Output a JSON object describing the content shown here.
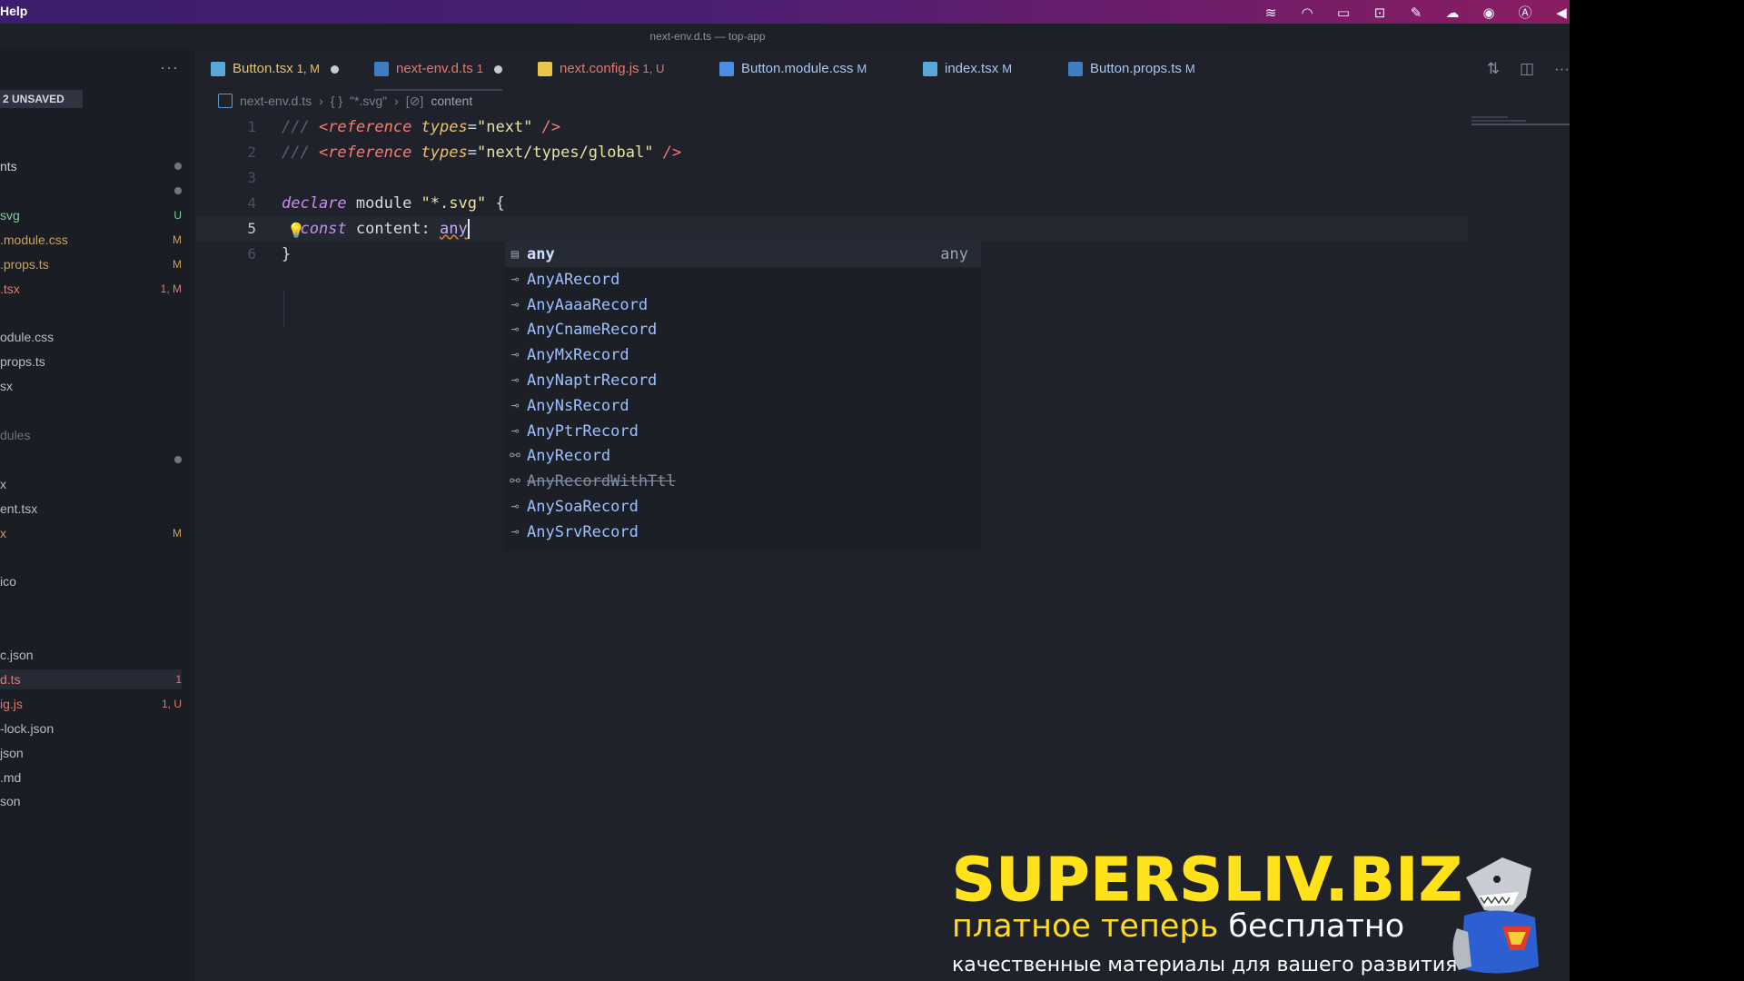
{
  "menubar": {
    "help": "Help",
    "tray_icons": [
      "stripe-icon",
      "headphones-icon",
      "card-icon",
      "camera-icon",
      "feather-icon",
      "cloud-icon",
      "compass-icon",
      "a-icon",
      "volume-icon"
    ]
  },
  "window": {
    "title": "next-env.d.ts — top-app"
  },
  "sidebar": {
    "more": "···",
    "unsaved": "2 UNSAVED",
    "files": [
      {
        "name": "nts",
        "badge": "",
        "color": "#c9cdd6",
        "dot": true
      },
      {
        "name": "",
        "badge": "",
        "color": "#c9cdd6",
        "dot": true
      },
      {
        "name": "svg",
        "badge": "U",
        "color": "#7ad39a"
      },
      {
        "name": ".module.css",
        "badge": "M",
        "color": "#c9a35a"
      },
      {
        "name": ".props.ts",
        "badge": "M",
        "color": "#c9a35a"
      },
      {
        "name": ".tsx",
        "badge": "1, M",
        "color": "#e07a70"
      },
      {
        "name": "",
        "badge": "",
        "color": "#c9cdd6"
      },
      {
        "name": "odule.css",
        "badge": "",
        "color": "#b8bcc6"
      },
      {
        "name": "props.ts",
        "badge": "",
        "color": "#b8bcc6"
      },
      {
        "name": "sx",
        "badge": "",
        "color": "#b8bcc6"
      },
      {
        "name": "",
        "badge": "",
        "color": "#c9cdd6"
      },
      {
        "name": "dules",
        "badge": "",
        "color": "#6c7180"
      },
      {
        "name": "",
        "badge": "",
        "color": "#c9cdd6",
        "dot": true
      },
      {
        "name": "x",
        "badge": "",
        "color": "#b8bcc6"
      },
      {
        "name": "ent.tsx",
        "badge": "",
        "color": "#b8bcc6"
      },
      {
        "name": "x",
        "badge": "M",
        "color": "#c9a35a"
      },
      {
        "name": "",
        "badge": "",
        "color": "#c9cdd6"
      },
      {
        "name": "ico",
        "badge": "",
        "color": "#b8bcc6"
      },
      {
        "name": "",
        "badge": "",
        "color": "#c9cdd6"
      },
      {
        "name": "",
        "badge": "",
        "color": "#c9cdd6"
      },
      {
        "name": "c.json",
        "badge": "",
        "color": "#b8bcc6"
      },
      {
        "name": "d.ts",
        "badge": "1",
        "color": "#e07a70",
        "selected": true
      },
      {
        "name": "ig.js",
        "badge": "1, U",
        "color": "#e07a70"
      },
      {
        "name": "-lock.json",
        "badge": "",
        "color": "#b8bcc6"
      },
      {
        "name": "json",
        "badge": "",
        "color": "#b8bcc6"
      },
      {
        "name": ".md",
        "badge": "",
        "color": "#b8bcc6"
      },
      {
        "name": "son",
        "badge": "",
        "color": "#b8bcc6"
      }
    ]
  },
  "tabs": [
    {
      "label": "Button.tsx",
      "status": "1, M",
      "dirty": true,
      "color": "#e3c275",
      "icon_color": "#5aa8d9",
      "icon": "react-icon"
    },
    {
      "label": "next-env.d.ts",
      "status": "1",
      "dirty": true,
      "color": "#e07a70",
      "icon_color": "#3d7fc1",
      "icon": "typescript-icon",
      "active": true
    },
    {
      "label": "next.config.js",
      "status": "1, U",
      "dirty": false,
      "color": "#e07a70",
      "icon_color": "#e6c54a",
      "icon": "javascript-icon"
    },
    {
      "label": "Button.module.css",
      "status": "M",
      "dirty": false,
      "color": "#a9c6f2",
      "icon_color": "#4c8fe0",
      "icon": "css-icon"
    },
    {
      "label": "index.tsx",
      "status": "M",
      "dirty": false,
      "color": "#a9c6f2",
      "icon_color": "#5aa8d9",
      "icon": "react-icon"
    },
    {
      "label": "Button.props.ts",
      "status": "M",
      "dirty": false,
      "color": "#a9c6f2",
      "icon_color": "#3d7fc1",
      "icon": "typescript-icon"
    }
  ],
  "editor_actions": [
    "source-control-icon",
    "split-editor-icon",
    "more-actions-icon"
  ],
  "breadcrumb": {
    "file": "next-env.d.ts",
    "module": "\"*.svg\"",
    "symbol": "content"
  },
  "code_lines": [
    {
      "n": "1",
      "tokens": [
        [
          "c-comment",
          "/// "
        ],
        [
          "c-tag",
          "<reference "
        ],
        [
          "c-attr",
          "types"
        ],
        [
          "c-punc",
          "="
        ],
        [
          "c-str",
          "\"next\""
        ],
        [
          "c-tag",
          " />"
        ]
      ]
    },
    {
      "n": "2",
      "tokens": [
        [
          "c-comment",
          "/// "
        ],
        [
          "c-tag",
          "<reference "
        ],
        [
          "c-attr",
          "types"
        ],
        [
          "c-punc",
          "="
        ],
        [
          "c-str",
          "\"next/types/global\""
        ],
        [
          "c-tag",
          " />"
        ]
      ]
    },
    {
      "n": "3",
      "tokens": []
    },
    {
      "n": "4",
      "tokens": [
        [
          "c-kw",
          "declare"
        ],
        [
          "c-id",
          " module "
        ],
        [
          "c-str",
          "\"*.svg\""
        ],
        [
          "c-punc",
          " {"
        ]
      ]
    },
    {
      "n": "5",
      "tokens": [
        [
          "c-kw",
          "  const"
        ],
        [
          "c-id",
          " content"
        ],
        [
          "c-punc",
          ": "
        ],
        [
          "c-type squig",
          "any"
        ]
      ],
      "current": true
    },
    {
      "n": "6",
      "tokens": [
        [
          "c-punc",
          "}"
        ]
      ]
    }
  ],
  "suggestions": {
    "detail": "any",
    "items": [
      {
        "label": "any",
        "icon": "keyword-icon",
        "selected": true
      },
      {
        "label": "AnyARecord",
        "icon": "interface-icon"
      },
      {
        "label": "AnyAaaaRecord",
        "icon": "interface-icon"
      },
      {
        "label": "AnyCnameRecord",
        "icon": "interface-icon"
      },
      {
        "label": "AnyMxRecord",
        "icon": "interface-icon"
      },
      {
        "label": "AnyNaptrRecord",
        "icon": "interface-icon"
      },
      {
        "label": "AnyNsRecord",
        "icon": "interface-icon"
      },
      {
        "label": "AnyPtrRecord",
        "icon": "interface-icon"
      },
      {
        "label": "AnyRecord",
        "icon": "type-alias-icon"
      },
      {
        "label": "AnyRecordWithTtl",
        "icon": "type-alias-icon",
        "deprecated": true
      },
      {
        "label": "AnySoaRecord",
        "icon": "interface-icon"
      },
      {
        "label": "AnySrvRecord",
        "icon": "interface-icon"
      }
    ]
  },
  "watermark": {
    "title": "SUPERSLIV.BIZ",
    "sub_yellow": "платное теперь",
    "sub_white": "бесплатно",
    "tagline": "качественные материалы для вашего развития"
  }
}
